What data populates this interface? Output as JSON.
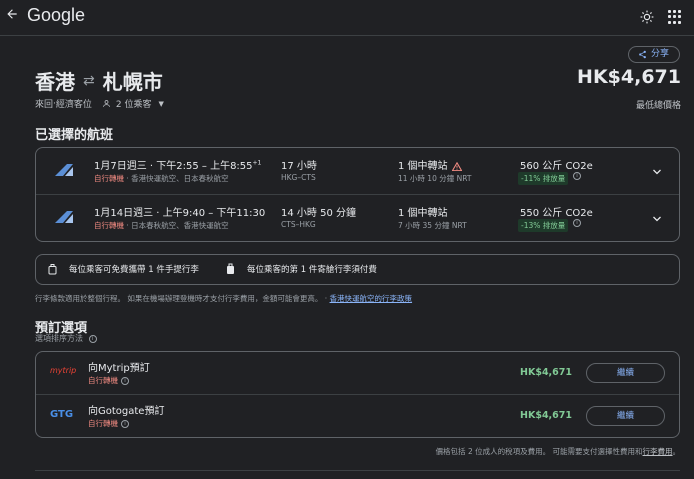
{
  "header": {
    "logo": "Google"
  },
  "share_label": "分享",
  "trip": {
    "origin": "香港",
    "destination": "札幌市",
    "arrow": "⇄",
    "trip_type": "來回",
    "cabin": "經濟客位",
    "passengers": "2 位乘客",
    "price": "HK$4,671",
    "price_label": "最低總價格"
  },
  "selected_title": "已選擇的航班",
  "flights": [
    {
      "date_time": "1月7日週三 · 下午2:55 – 上午8:55",
      "plus_day": "+1",
      "self_transfer": "自行轉機",
      "airlines": "香港快運航空、日本春秋航空",
      "duration": "17 小時",
      "route": "HKG–CTS",
      "stops": "1 個中轉站",
      "stop_detail": "11 小時 10 分鐘 NRT",
      "co2": "560 公斤 CO2e",
      "co2_badge": "-11% 排放量"
    },
    {
      "date_time": "1月14日週三 · 上午9:40 – 下午11:30",
      "plus_day": "",
      "self_transfer": "自行轉機",
      "airlines": "日本春秋航空、香港快運航空",
      "duration": "14 小時 50 分鐘",
      "route": "CTS–HKG",
      "stops": "1 個中轉站",
      "stop_detail": "7 小時 35 分鐘 NRT",
      "co2": "550 公斤 CO2e",
      "co2_badge": "-13% 排放量"
    }
  ],
  "baggage": {
    "carry_on": "每位乘客可免費攜帶 1 件手提行李",
    "checked": "每位乘客的第 1 件寄艙行李須付費"
  },
  "policy": {
    "text": "行李條款適用於整個行程。 如果在機場辦理登機時才支付行李費用，金額可能會更高。",
    "link": "香港快運航空的行李政策"
  },
  "booking_title": "預訂選項",
  "sort_label": "選項排序方法",
  "vendors": [
    {
      "logo": "mytrip",
      "name": "向Mytrip預訂",
      "note": "自行轉機",
      "price": "HK$4,671",
      "button": "繼續",
      "color": "#ea4335"
    },
    {
      "logo": "GTG",
      "name": "向Gotogate預訂",
      "note": "自行轉機",
      "price": "HK$4,671",
      "button": "繼續",
      "color": "#4a8fe7"
    }
  ],
  "footer": {
    "text": "價格包括 2 位成人的稅項及費用。 可能需要支付選擇性費用和",
    "link": "行李費用",
    "end": "。"
  },
  "colors": {
    "background": "#202124",
    "accent": "#8ab4f8",
    "green": "#81c995",
    "red": "#f28b82"
  }
}
